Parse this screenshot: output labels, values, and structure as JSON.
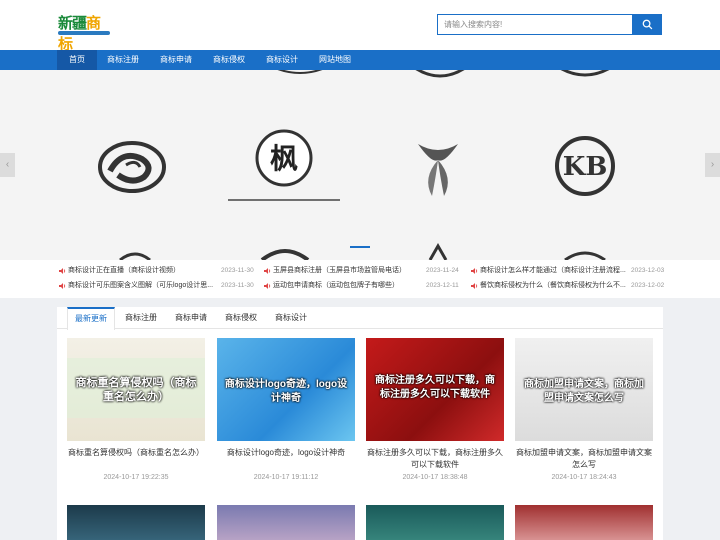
{
  "header": {
    "logo_text_a": "新疆",
    "logo_text_b": "商标",
    "search_placeholder": "请输入搜索内容!"
  },
  "nav": {
    "items": [
      "首页",
      "商标注册",
      "商标申请",
      "商标侵权",
      "商标设计",
      "网站地图"
    ]
  },
  "banner": {
    "prev": "‹",
    "next": "›",
    "logo_char": "枫",
    "logo_kb": "KB"
  },
  "news": [
    {
      "title": "商标设计正在直播（商标设计视频）",
      "date": "2023-11-30"
    },
    {
      "title": "玉屏县商标注册（玉屏县市场监管局电话）",
      "date": "2023-11-24"
    },
    {
      "title": "商标设计怎么样才能通过（商标设计注册流程...",
      "date": "2023-12-03"
    },
    {
      "title": "商标设计可乐图案含义图解（可乐logo设计思...",
      "date": "2023-11-30"
    },
    {
      "title": "运动包申请商标（运动包包牌子有哪些）",
      "date": "2023-12-11"
    },
    {
      "title": "餐饮商标侵权为什么（餐饮商标侵权为什么不...",
      "date": "2023-12-02"
    }
  ],
  "tabs": [
    "最新更新",
    "商标注册",
    "商标申请",
    "商标侵权",
    "商标设计"
  ],
  "cards": [
    {
      "thumb_text": "商标重名算侵权吗（商标重名怎么办）",
      "title": "商标重名算侵权吗（商标重名怎么办）",
      "date": "2024-10-17 19:22:35"
    },
    {
      "thumb_text": "商标设计logo奇迹，logo设计神奇",
      "title": "商标设计logo奇迹，logo设计神奇",
      "date": "2024-10-17 19:11:12"
    },
    {
      "thumb_text": "商标注册多久可以下载，商标注册多久可以下载软件",
      "title": "商标注册多久可以下载，商标注册多久可以下载软件",
      "date": "2024-10-17 18:38:48"
    },
    {
      "thumb_text": "商标加盟申请文案，商标加盟申请文案怎么写",
      "title": "商标加盟申请文案，商标加盟申请文案怎么写",
      "date": "2024-10-17 18:24:43"
    }
  ],
  "colors": {
    "brand": "#1a6fc7",
    "nav_active": "#1558a6",
    "card3_bg": "#c41a1a"
  }
}
